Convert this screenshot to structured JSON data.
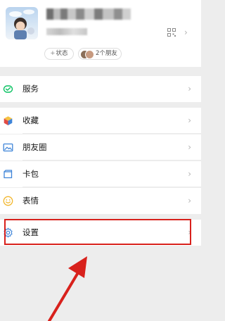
{
  "profile": {
    "status_label": "状态",
    "status_plus": "+",
    "friends_label": "2个朋友"
  },
  "menu": {
    "service": "服务",
    "favorites": "收藏",
    "moments": "朋友圈",
    "cards": "卡包",
    "stickers": "表情",
    "settings": "设置"
  },
  "chevron": "›",
  "colors": {
    "highlight": "#d8211c",
    "wechat_green": "#07c160",
    "icon_blue": "#3e84d8",
    "icon_yellow": "#f2b62c"
  }
}
